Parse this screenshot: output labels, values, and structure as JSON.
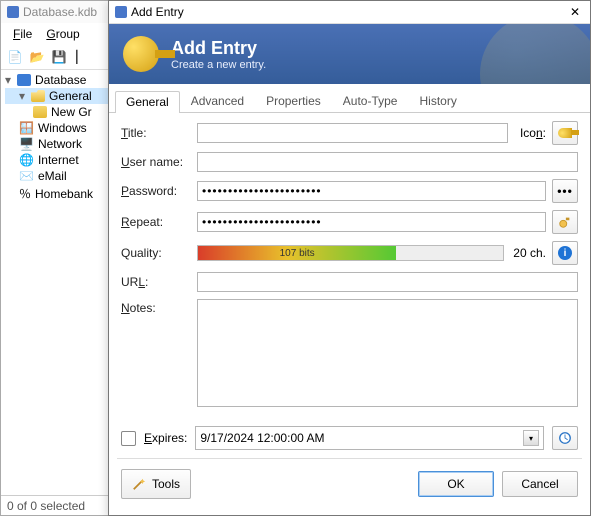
{
  "main": {
    "title": "Database.kdb",
    "menu": {
      "file": "File",
      "group": "Group"
    },
    "tree": {
      "root": "Database",
      "general": "General",
      "items": [
        "New Gr",
        "Windows",
        "Network",
        "Internet",
        "eMail",
        "Homebank"
      ]
    },
    "status": "0 of 0 selected"
  },
  "dialog": {
    "title": "Add Entry",
    "banner": {
      "title": "Add Entry",
      "subtitle": "Create a new entry."
    },
    "tabs": [
      "General",
      "Advanced",
      "Properties",
      "Auto-Type",
      "History"
    ],
    "labels": {
      "title": "Title:",
      "icon": "Icon:",
      "username": "User name:",
      "password": "Password:",
      "repeat": "Repeat:",
      "quality": "Quality:",
      "url": "URL:",
      "notes": "Notes:",
      "expires": "Expires:"
    },
    "values": {
      "title": "",
      "username": "",
      "password_masked": "•••••••••••••••••••••••",
      "repeat_masked": "•••••••••••••••••••••••",
      "quality_text": "107 bits",
      "quality_fill_pct": 65,
      "char_count": "20 ch.",
      "url": "",
      "notes": "",
      "expires_checked": false,
      "expires_date": "9/17/2024 12:00:00 AM"
    },
    "buttons": {
      "tools": "Tools",
      "ok": "OK",
      "cancel": "Cancel"
    }
  }
}
